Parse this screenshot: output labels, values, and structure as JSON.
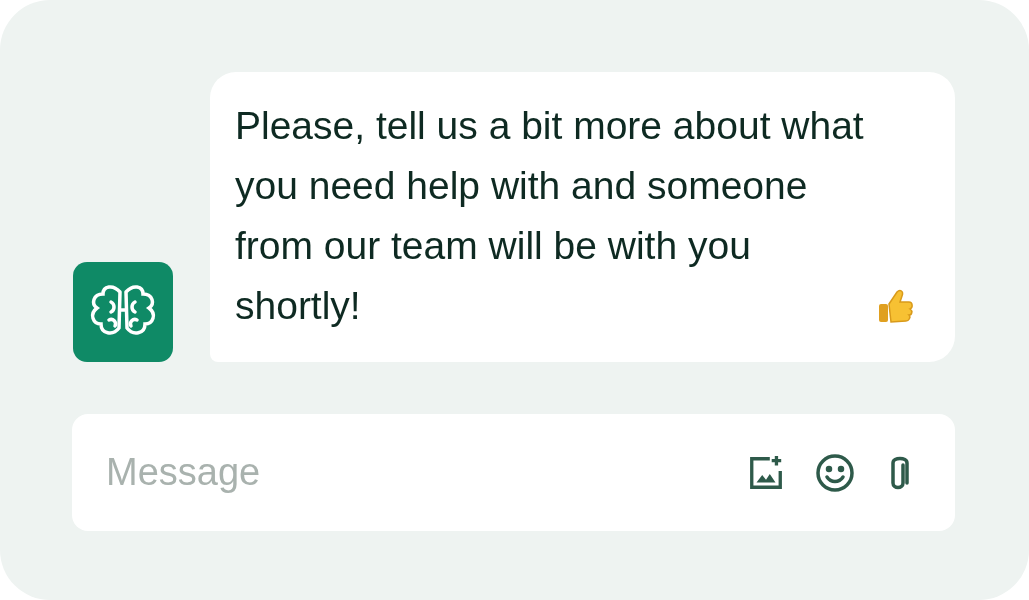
{
  "chat": {
    "message": "Please, tell us a bit more about what you need help with and someone from our team will be with you shortly!"
  },
  "composer": {
    "placeholder": "Message"
  }
}
